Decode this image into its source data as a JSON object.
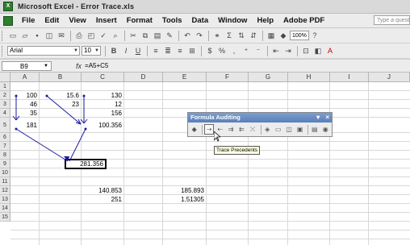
{
  "window": {
    "title": "Microsoft Excel - Error Trace.xls"
  },
  "menu": {
    "items": [
      "File",
      "Edit",
      "View",
      "Insert",
      "Format",
      "Tools",
      "Data",
      "Window",
      "Help",
      "Adobe PDF"
    ],
    "help_placeholder": "Type a question for help"
  },
  "toolbar": {
    "zoom": "100%"
  },
  "format_toolbar": {
    "font": "Arial",
    "size": "10",
    "bold": "B",
    "italic": "I",
    "underline": "U",
    "currency": "$",
    "percent": "%"
  },
  "formula_bar": {
    "name_box": "B9",
    "fx": "fx",
    "formula": "=A5+C5"
  },
  "columns": [
    "A",
    "B",
    "C",
    "D",
    "E",
    "F",
    "G",
    "H",
    "I",
    "J"
  ],
  "rows": [
    "1",
    "2",
    "3",
    "4",
    "5",
    "6",
    "7",
    "8",
    "9",
    "10",
    "11",
    "12",
    "13",
    "14",
    "15"
  ],
  "cells": {
    "A2": "100",
    "B2": "15.6",
    "C2": "130",
    "A3": "46",
    "B3": "23",
    "C3": "12",
    "A4": "35",
    "C4": "156",
    "A5": "181",
    "C5": "100.356",
    "B9": "281.356",
    "C12": "140.853",
    "E12": "185.893",
    "C13": "251",
    "E13": "1.51305"
  },
  "auditing_toolbar": {
    "title": "Formula Auditing",
    "dropdown_glyph": "▾",
    "close_glyph": "×",
    "tooltip": "Trace Precedents"
  },
  "colors": {
    "accent": "#5a7fb8",
    "arrow": "#1a1aa0"
  }
}
